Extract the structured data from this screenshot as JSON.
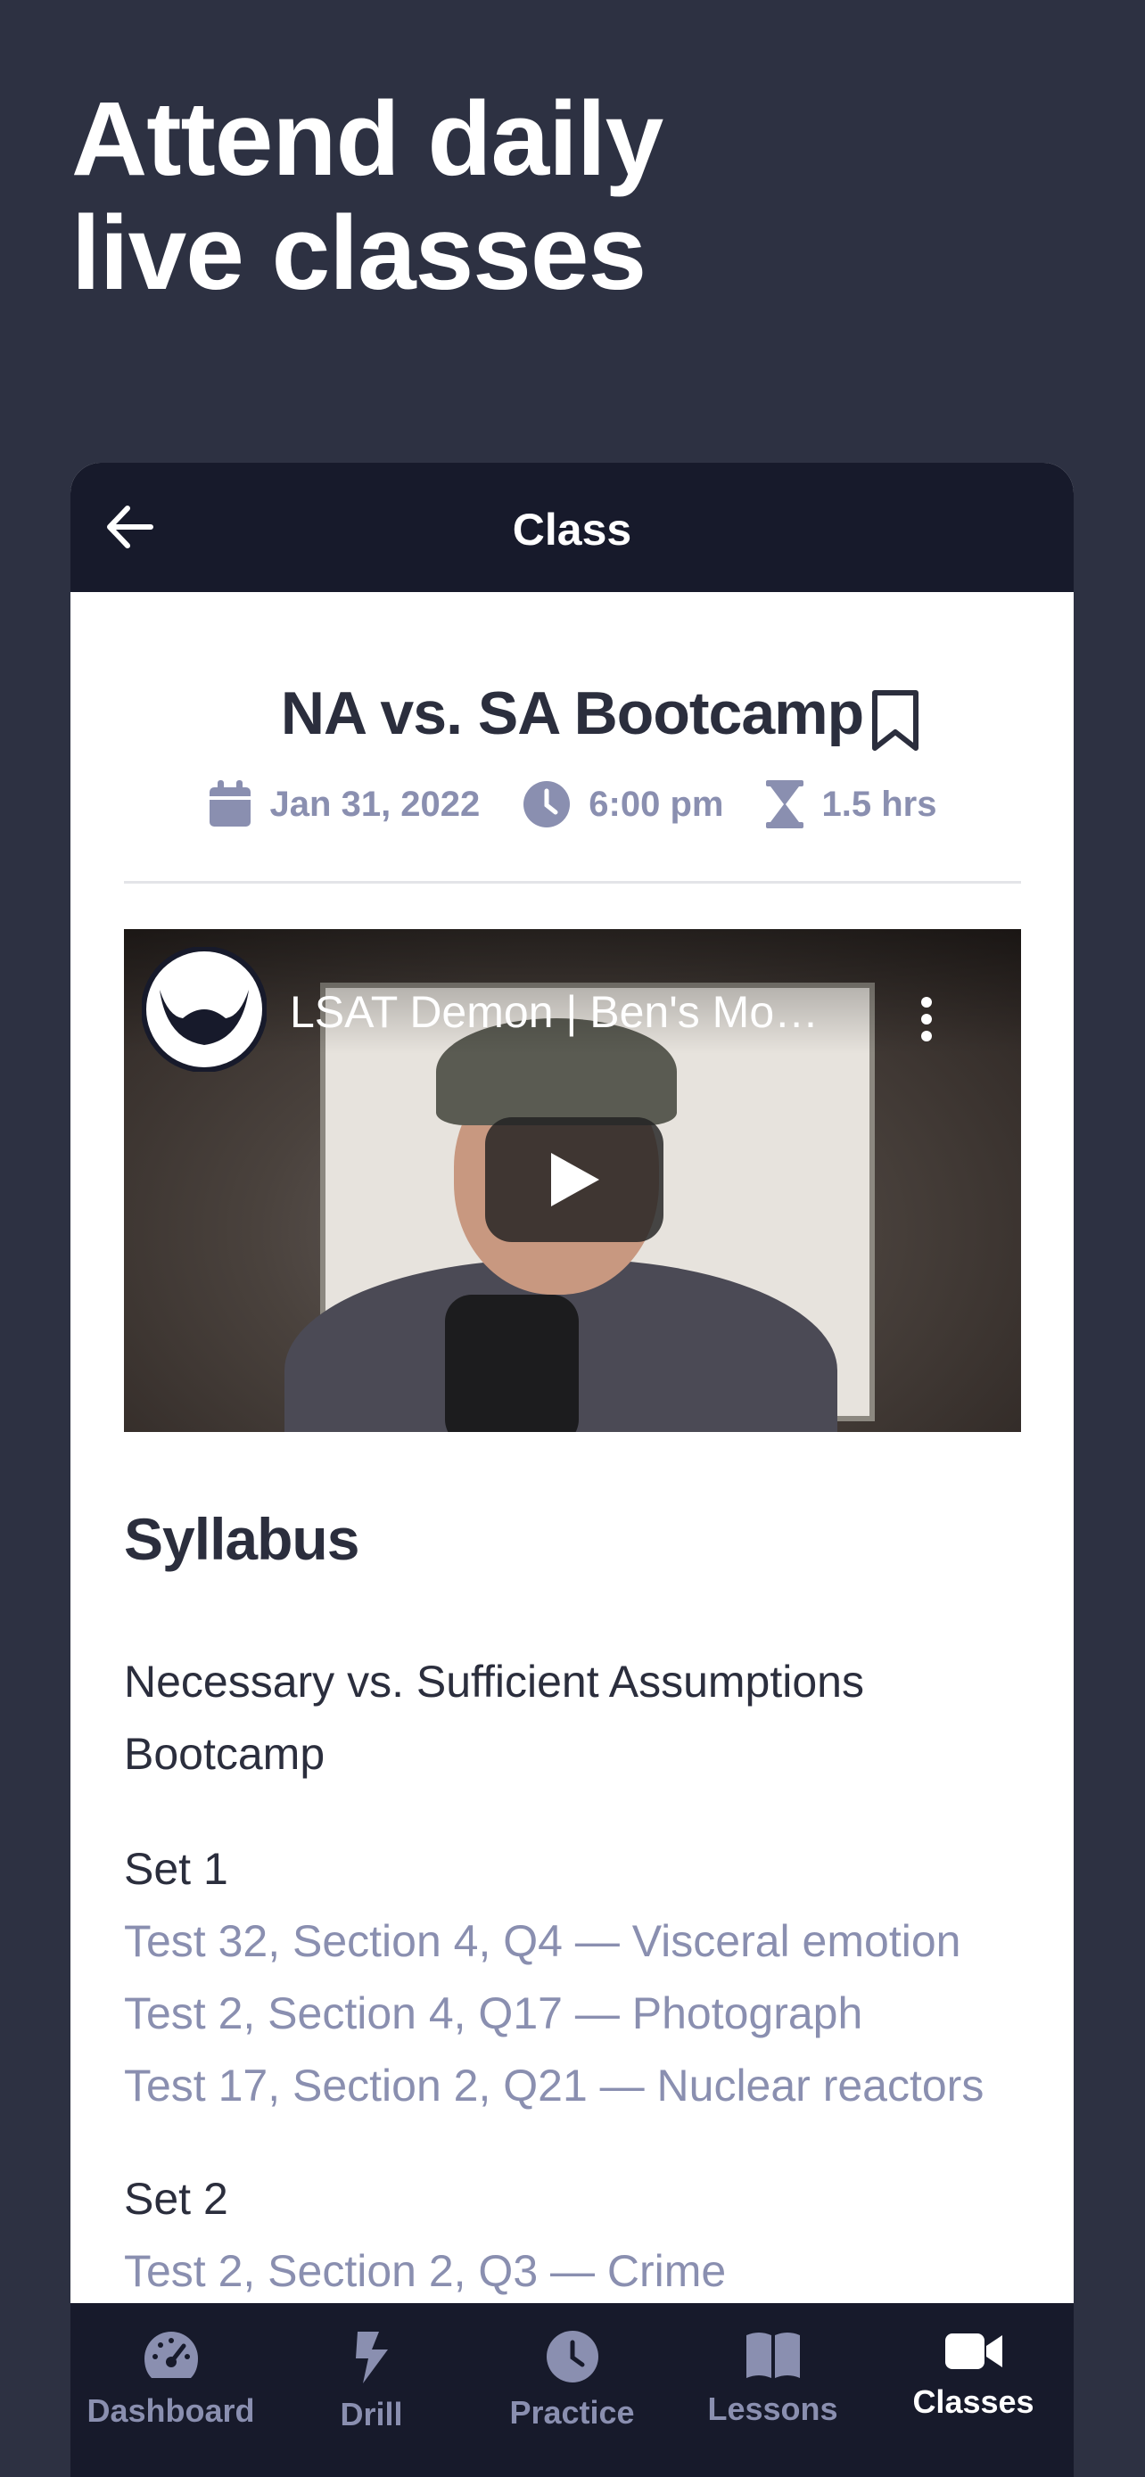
{
  "headline": {
    "line1": "Attend daily",
    "line2": "live classes"
  },
  "topbar": {
    "title": "Class"
  },
  "class": {
    "title": "NA vs. SA Bootcamp",
    "date": "Jan 31, 2022",
    "time": "6:00 pm",
    "duration": "1.5 hrs"
  },
  "video": {
    "title": "LSAT Demon | Ben's Mo…"
  },
  "syllabus": {
    "heading": "Syllabus",
    "intro": "Necessary vs. Sufficient Assumptions Bootcamp",
    "sets": [
      {
        "label": "Set 1",
        "questions": [
          "Test 32, Section 4, Q4 — Visceral emotion",
          "Test 2, Section 4, Q17 — Photograph",
          "Test 17, Section 2, Q21 — Nuclear reactors"
        ]
      },
      {
        "label": "Set 2",
        "questions": [
          "Test 2, Section 2, Q3 — Crime"
        ]
      }
    ]
  },
  "tabs": [
    {
      "label": "Dashboard",
      "icon": "dashboard-icon"
    },
    {
      "label": "Drill",
      "icon": "lightning-icon"
    },
    {
      "label": "Practice",
      "icon": "clock-icon"
    },
    {
      "label": "Lessons",
      "icon": "book-icon"
    },
    {
      "label": "Classes",
      "icon": "video-camera-icon",
      "active": true
    }
  ],
  "colors": {
    "background": "#2d3142",
    "bar": "#171a2b",
    "accent_muted": "#8a8fb0",
    "text_dark": "#2b2e3d"
  }
}
